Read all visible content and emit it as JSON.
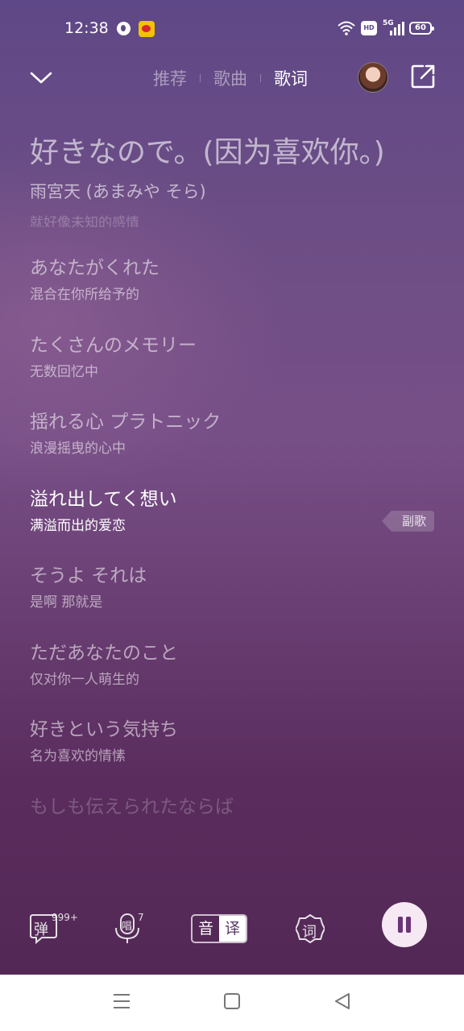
{
  "status_bar": {
    "time": "12:38",
    "network": "5G",
    "battery": "60",
    "hd": "HD"
  },
  "nav": {
    "tabs": [
      {
        "label": "推荐"
      },
      {
        "label": "歌曲"
      },
      {
        "label": "歌词"
      }
    ],
    "active_tab": "歌词"
  },
  "song": {
    "title": "好きなので。(因为喜欢你。)",
    "artist": "雨宮天 (あまみや そら)",
    "prev_line_faded": "就好像未知的感情"
  },
  "lyrics": [
    {
      "jp": "あなたがくれた",
      "cn": "混合在你所给予的"
    },
    {
      "jp": "たくさんのメモリー",
      "cn": "无数回忆中"
    },
    {
      "jp": "揺れる心 プラトニック",
      "cn": "浪漫摇曳的心中"
    },
    {
      "jp": "溢れ出してく想い",
      "cn": "满溢而出的爱恋"
    },
    {
      "jp": "そうよ それは",
      "cn": "是啊 那就是"
    },
    {
      "jp": "ただあなたのこと",
      "cn": "仅对你一人萌生的"
    },
    {
      "jp": "好きという気持ち",
      "cn": "名为喜欢的情愫"
    },
    {
      "jp": "もしも伝えられたならば",
      "cn": ""
    }
  ],
  "active_line_index": 3,
  "chorus_tag": "副歌",
  "toolbar": {
    "danmaku_label": "弹",
    "danmaku_count": "999+",
    "sing_label": "唱",
    "sing_count": "7",
    "toggle_left": "音",
    "toggle_right": "译",
    "lyrics_label": "词"
  },
  "colors": {
    "bg_top": "#5f4887",
    "bg_bottom": "#532855",
    "pause_button": "#f6e9f4",
    "pause_icon": "#6a3576"
  }
}
